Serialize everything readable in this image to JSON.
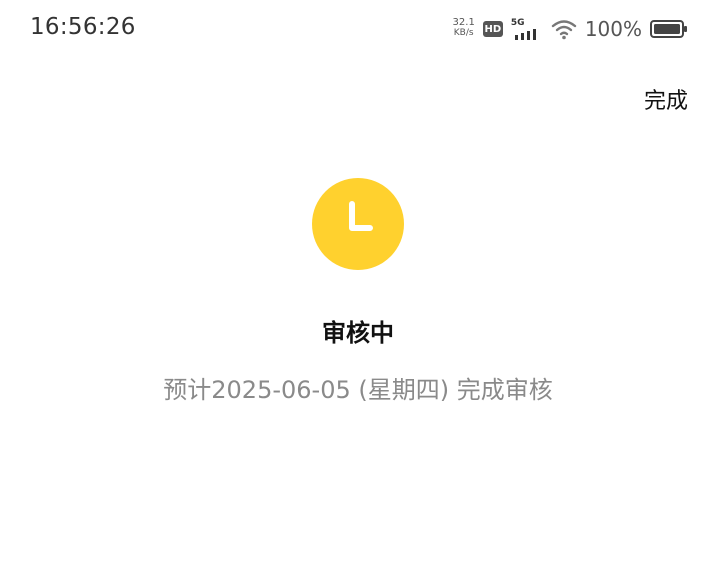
{
  "status_bar": {
    "time": "16:56:26",
    "net_speed_value": "32.1",
    "net_speed_unit": "KB/s",
    "hd_label": "HD",
    "network_type": "5G",
    "battery_percent": "100%"
  },
  "header": {
    "done_label": "完成"
  },
  "review": {
    "title": "审核中",
    "description": "预计2025-06-05 (星期四) 完成审核",
    "icon": "clock-icon",
    "icon_color": "#FFD12E"
  }
}
